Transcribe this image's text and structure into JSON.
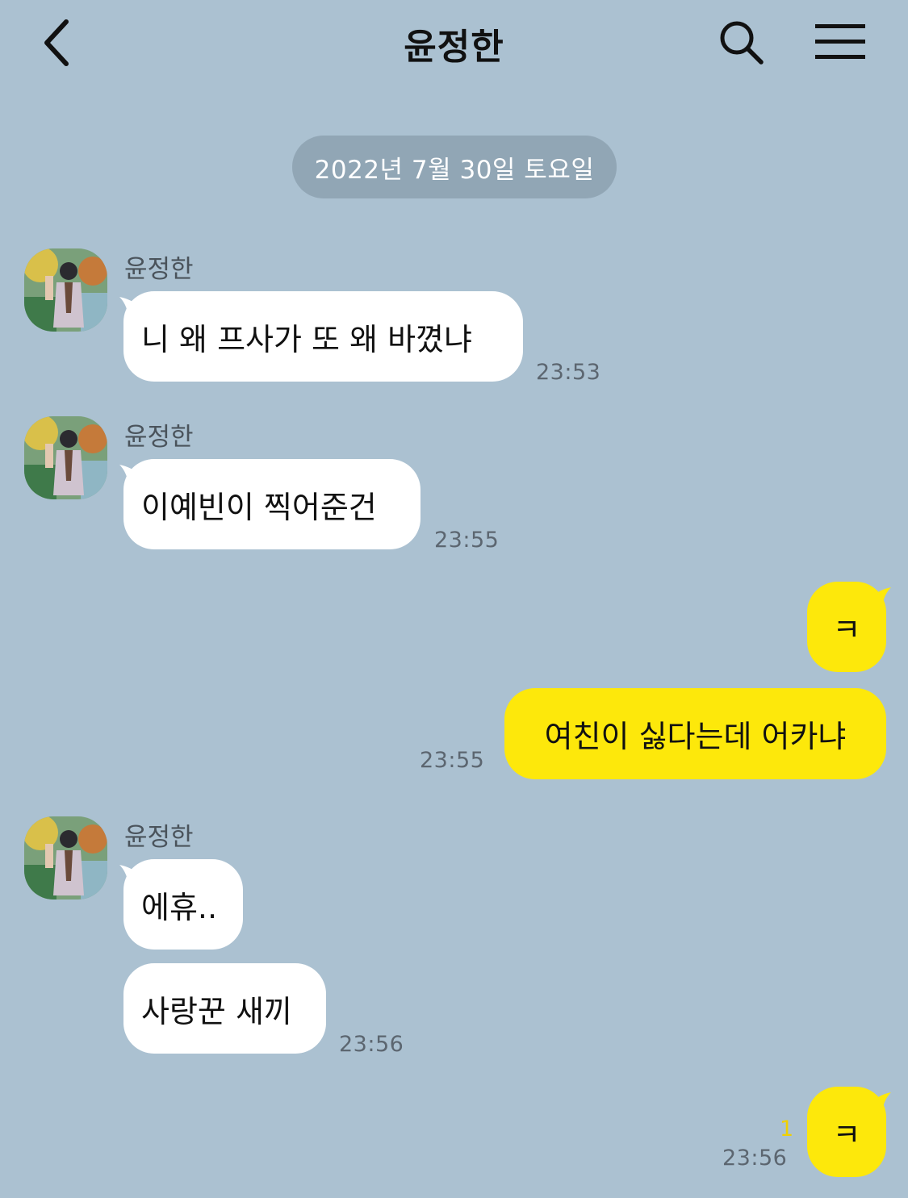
{
  "header": {
    "title": "윤정한",
    "back_icon": "chevron-left-icon",
    "search_icon": "search-icon",
    "menu_icon": "hamburger-menu-icon"
  },
  "date_divider": "2022년 7월 30일 토요일",
  "colors": {
    "background": "#abc1d1",
    "incoming_bubble": "#ffffff",
    "outgoing_bubble": "#fde80b",
    "date_pill": "#91a6b5",
    "unread_count": "#f0d000"
  },
  "messages": [
    {
      "sender": "윤정한",
      "text": "니 왜 프사가 또 왜 바꼈냐",
      "time": "23:53"
    },
    {
      "sender": "윤정한",
      "text": "이예빈이 찍어준건",
      "time": "23:55"
    },
    {
      "sender": "me",
      "text": "ㅋ",
      "time": ""
    },
    {
      "sender": "me",
      "text": "여친이 싫다는데 어카냐",
      "time": "23:55"
    },
    {
      "sender": "윤정한",
      "text": "에휴..",
      "time": ""
    },
    {
      "sender": "윤정한",
      "text": "사랑꾼 새끼",
      "time": "23:56"
    },
    {
      "sender": "me",
      "text": "ㅋ",
      "time": "23:56",
      "unread": "1"
    }
  ]
}
